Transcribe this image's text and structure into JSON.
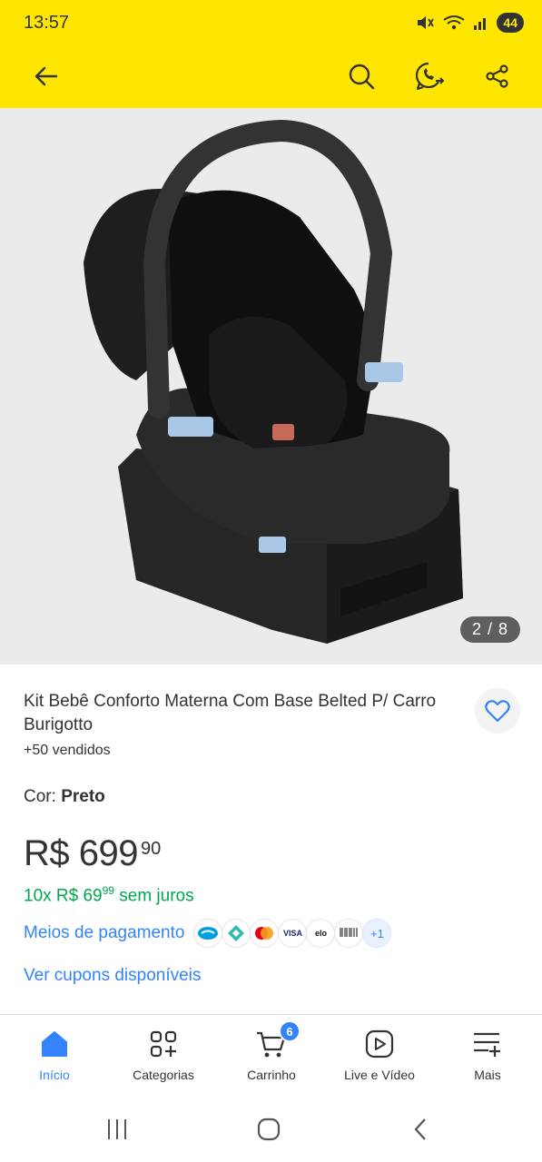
{
  "status_bar": {
    "time": "13:57",
    "battery": "44"
  },
  "top_bar": {
    "back": "back-arrow-icon",
    "search": "search-icon",
    "whatsapp": "whatsapp-icon",
    "share": "share-icon"
  },
  "gallery": {
    "counter": "2 / 8"
  },
  "product": {
    "title": "Kit Bebê Conforto Materna Com Base Belted P/ Carro Burigotto",
    "sold": "+50 vendidos",
    "color_label": "Cor: ",
    "color_value": "Preto",
    "price_main": "R$ 699",
    "price_cents": "90",
    "installments_prefix": "10x R$ 69",
    "installments_cents": "99",
    "installments_suffix": " sem juros",
    "payment_label": "Meios de pagamento",
    "payment_methods": [
      "Mercado Pago",
      "Pix",
      "Mastercard",
      "VISA",
      "elo",
      "Boleto"
    ],
    "payment_more": "+1",
    "coupons_link": "Ver cupons disponíveis"
  },
  "bottom_nav": [
    {
      "label": "Início",
      "icon": "home-icon",
      "active": true
    },
    {
      "label": "Categorias",
      "icon": "categories-icon"
    },
    {
      "label": "Carrinho",
      "icon": "cart-icon",
      "badge": "6"
    },
    {
      "label": "Live e Vídeo",
      "icon": "play-icon"
    },
    {
      "label": "Mais",
      "icon": "menu-icon"
    }
  ],
  "colors": {
    "brand_yellow": "#ffe600",
    "link_blue": "#3483fa",
    "success_green": "#00a650"
  }
}
